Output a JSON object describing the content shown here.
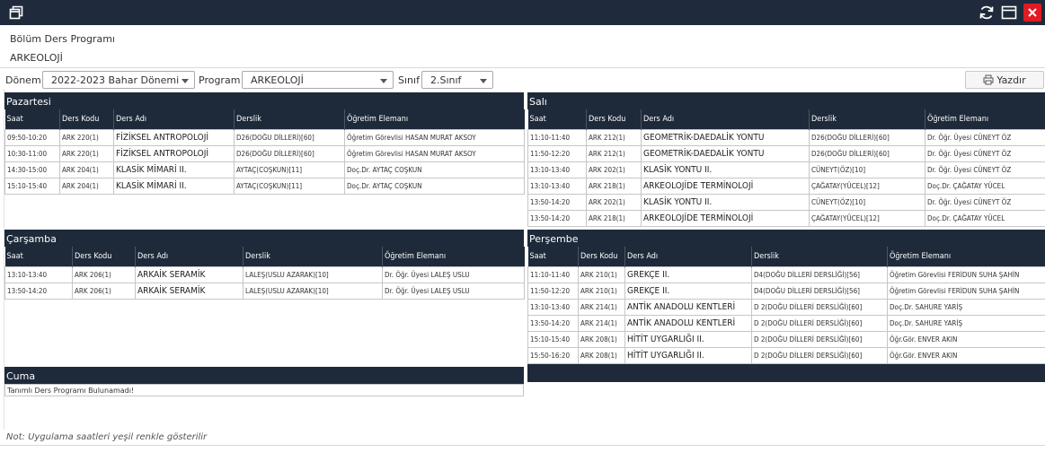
{
  "window": {
    "colors": {
      "titlebar": "#1f2b3c",
      "close": "#e01b24"
    }
  },
  "header": {
    "title": "Bölüm Ders Programı",
    "program": "ARKEOLOJİ"
  },
  "filters": {
    "donem_label": "Dönem",
    "donem_value": "2022-2023 Bahar Dönemi",
    "program_label": "Program",
    "program_value": "ARKEOLOJİ",
    "sinif_label": "Sınıf",
    "sinif_value": "2.Sınıf",
    "print_label": "Yazdır"
  },
  "columns": {
    "saat": "Saat",
    "kod": "Ders Kodu",
    "ad": "Ders Adı",
    "derslik": "Derslik",
    "ogretim": "Öğretim Elemanı"
  },
  "days": {
    "pazartesi": {
      "name": "Pazartesi",
      "rows": [
        [
          "09:50-10:20",
          "ARK 220(1)",
          "FİZİKSEL ANTROPOLOJİ",
          "D26(DOĞU DİLLERİ)[60]",
          "Öğretim Görevlisi HASAN MURAT AKSOY"
        ],
        [
          "10:30-11:00",
          "ARK 220(1)",
          "FİZİKSEL ANTROPOLOJİ",
          "D26(DOĞU DİLLERİ)[60]",
          "Öğretim Görevlisi HASAN MURAT AKSOY"
        ],
        [
          "14:30-15:00",
          "ARK 204(1)",
          "KLASİK MİMARİ II.",
          "AYTAÇ(COŞKUN)[11]",
          "Doç.Dr. AYTAÇ COŞKUN"
        ],
        [
          "15:10-15:40",
          "ARK 204(1)",
          "KLASİK MİMARİ II.",
          "AYTAÇ(COŞKUN)[11]",
          "Doç.Dr. AYTAÇ COŞKUN"
        ]
      ]
    },
    "sali": {
      "name": "Salı",
      "rows": [
        [
          "11:10-11:40",
          "ARK 212(1)",
          "GEOMETRİK-DAEDALİK YONTU",
          "D26(DOĞU DİLLERİ)[60]",
          "Dr. Öğr. Üyesi CÜNEYT ÖZ"
        ],
        [
          "11:50-12:20",
          "ARK 212(1)",
          "GEOMETRİK-DAEDALİK YONTU",
          "D26(DOĞU DİLLERİ)[60]",
          "Dr. Öğr. Üyesi CÜNEYT ÖZ"
        ],
        [
          "13:10-13:40",
          "ARK 202(1)",
          "KLASİK YONTU II.",
          "CÜNEYT(ÖZ)[10]",
          "Dr. Öğr. Üyesi CÜNEYT ÖZ"
        ],
        [
          "13:10-13:40",
          "ARK 218(1)",
          "ARKEOLOJİDE TERMİNOLOJİ",
          "ÇAĞATAY(YÜCEL)[12]",
          "Doç.Dr. ÇAĞATAY YÜCEL"
        ],
        [
          "13:50-14:20",
          "ARK 202(1)",
          "KLASİK YONTU II.",
          "CÜNEYT(ÖZ)[10]",
          "Dr. Öğr. Üyesi CÜNEYT ÖZ"
        ],
        [
          "13:50-14:20",
          "ARK 218(1)",
          "ARKEOLOJİDE TERMİNOLOJİ",
          "ÇAĞATAY(YÜCEL)[12]",
          "Doç.Dr. ÇAĞATAY YÜCEL"
        ]
      ]
    },
    "carsamba": {
      "name": "Çarşamba",
      "rows": [
        [
          "13:10-13:40",
          "ARK 206(1)",
          "ARKAİK SERAMİK",
          "LALEŞ(USLU AZARAK)[10]",
          "Dr. Öğr. Üyesi LALEŞ USLU"
        ],
        [
          "13:50-14:20",
          "ARK 206(1)",
          "ARKAİK SERAMİK",
          "LALEŞ(USLU AZARAK)[10]",
          "Dr. Öğr. Üyesi LALEŞ USLU"
        ]
      ]
    },
    "persembe": {
      "name": "Perşembe",
      "rows": [
        [
          "11:10-11:40",
          "ARK 210(1)",
          "GREKÇE II.",
          "D4(DOĞU DİLLERİ DERSLİĞİ)[56]",
          "Öğretim Görevlisi FERİDUN SUHA ŞAHİN"
        ],
        [
          "11:50-12:20",
          "ARK 210(1)",
          "GREKÇE II.",
          "D4(DOĞU DİLLERİ DERSLİĞİ)[56]",
          "Öğretim Görevlisi FERİDUN SUHA ŞAHİN"
        ],
        [
          "13:10-13:40",
          "ARK 214(1)",
          "ANTİK ANADOLU KENTLERİ",
          "D 2(DOĞU DİLLERİ DERSLİĞİ)[60]",
          "Doç.Dr. SAHURE YARİŞ"
        ],
        [
          "13:50-14:20",
          "ARK 214(1)",
          "ANTİK ANADOLU KENTLERİ",
          "D 2(DOĞU DİLLERİ DERSLİĞİ)[60]",
          "Doç.Dr. SAHURE YARİŞ"
        ],
        [
          "15:10-15:40",
          "ARK 208(1)",
          "HİTİT UYGARLIĞI II.",
          "D 2(DOĞU DİLLERİ DERSLİĞİ)[60]",
          "Öğr.Gör. ENVER AKIN"
        ],
        [
          "15:50-16:20",
          "ARK 208(1)",
          "HİTİT UYGARLIĞI II.",
          "D 2(DOĞU DİLLERİ DERSLİĞİ)[60]",
          "Öğr.Gör. ENVER AKIN"
        ]
      ]
    },
    "cuma": {
      "name": "Cuma",
      "empty_text": "Tanımlı Ders Programı Bulunamadı!"
    }
  },
  "note": "Not: Uygulama saatleri yeşil renkle gösterilir"
}
